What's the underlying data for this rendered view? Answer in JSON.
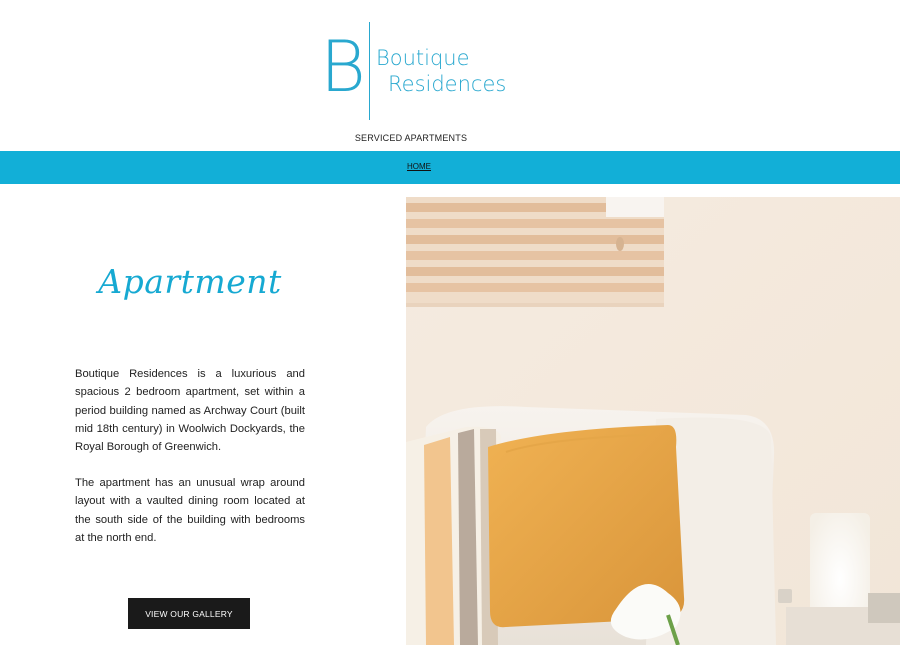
{
  "brand": {
    "logo_letter": "B",
    "name_line1": "Boutique",
    "name_line2": "Residences",
    "tagline": "SERVICED APARTMENTS",
    "accent_color": "#29a8cf"
  },
  "nav": {
    "bar_color": "#12afd7",
    "items": [
      {
        "label": "HOME"
      }
    ]
  },
  "main": {
    "heading": "Apartment",
    "paragraphs": [
      "Boutique Residences is a luxurious and spacious 2 bedroom apartment, set within a period building named as Archway Court (built mid 18th century) in Woolwich Dockyards, the Royal Borough of Greenwich.",
      "The apartment has an unusual wrap around layout with a vaulted dining room located at the south side of the building with bedrooms at the north end."
    ],
    "gallery_button": "VIEW OUR GALLERY"
  },
  "photo": {
    "subject": "bedroom with cushions, window blinds and lamp"
  }
}
